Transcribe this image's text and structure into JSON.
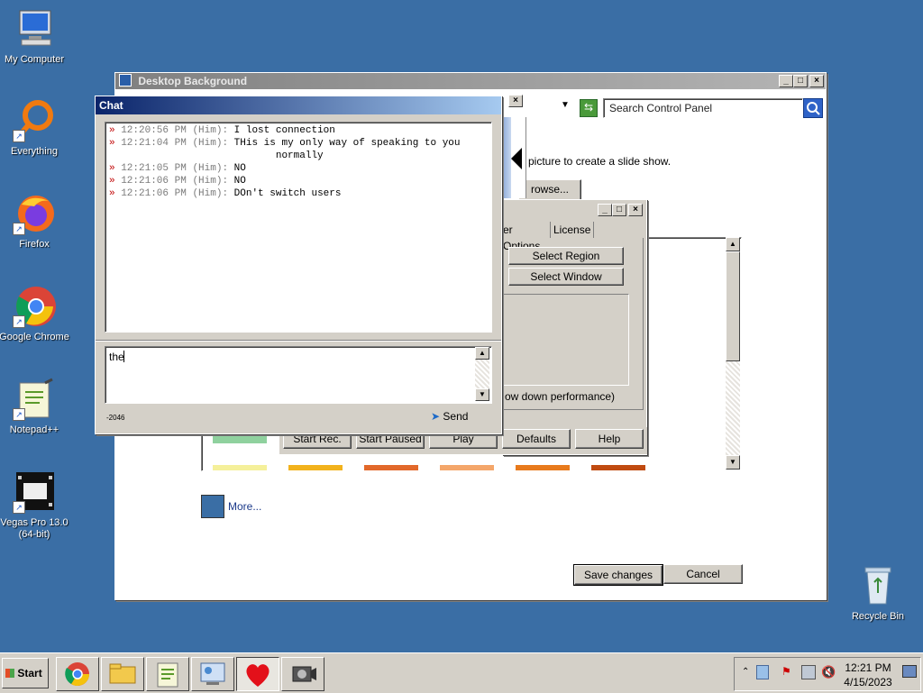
{
  "desktop": {
    "icons": [
      {
        "label": "My Computer"
      },
      {
        "label": "Everything"
      },
      {
        "label": "Firefox"
      },
      {
        "label": "Google Chrome"
      },
      {
        "label": "Notepad++"
      },
      {
        "label": "Vegas Pro 13.0 (64-bit)"
      },
      {
        "label": "Recycle Bin"
      }
    ]
  },
  "control_panel": {
    "title": "Desktop Background",
    "search_placeholder": "Search Control Panel",
    "instruction": "picture to create a slide show.",
    "browse_label": "rowse...",
    "more_label": "More...",
    "save_label": "Save changes",
    "cancel_label": "Cancel"
  },
  "recorder": {
    "tabs": [
      "er Options",
      "License"
    ],
    "select_region": "Select Region",
    "select_window": "Select Window",
    "perf_note": "ow down performance)",
    "start_rec": "Start Rec.",
    "start_paused": "Start Paused",
    "play": "Play",
    "defaults": "Defaults",
    "help": "Help"
  },
  "chat": {
    "title": "Chat",
    "messages": [
      {
        "time": "12:20:56 PM",
        "who": "(Him):",
        "text": "I lost connection"
      },
      {
        "time": "12:21:04 PM",
        "who": "(Him):",
        "text": "THis is my only way of speaking to you"
      },
      {
        "time": "",
        "who": "",
        "text": "normally"
      },
      {
        "time": "12:21:05 PM",
        "who": "(Him):",
        "text": "NO"
      },
      {
        "time": "12:21:06 PM",
        "who": "(Him):",
        "text": "NO"
      },
      {
        "time": "12:21:06 PM",
        "who": "(Him):",
        "text": "DOn't switch users"
      }
    ],
    "input_value": "the",
    "counter": "-2046",
    "send_label": "Send"
  },
  "taskbar": {
    "start_label": "Start",
    "time": "12:21 PM",
    "date": "4/15/2023"
  },
  "swatch_colors": [
    "#f5f09a",
    "#f2b21c",
    "#e2682a",
    "#f4a66a",
    "#e87a1c",
    "#c04a10"
  ],
  "accent_green": "#8fd19e"
}
